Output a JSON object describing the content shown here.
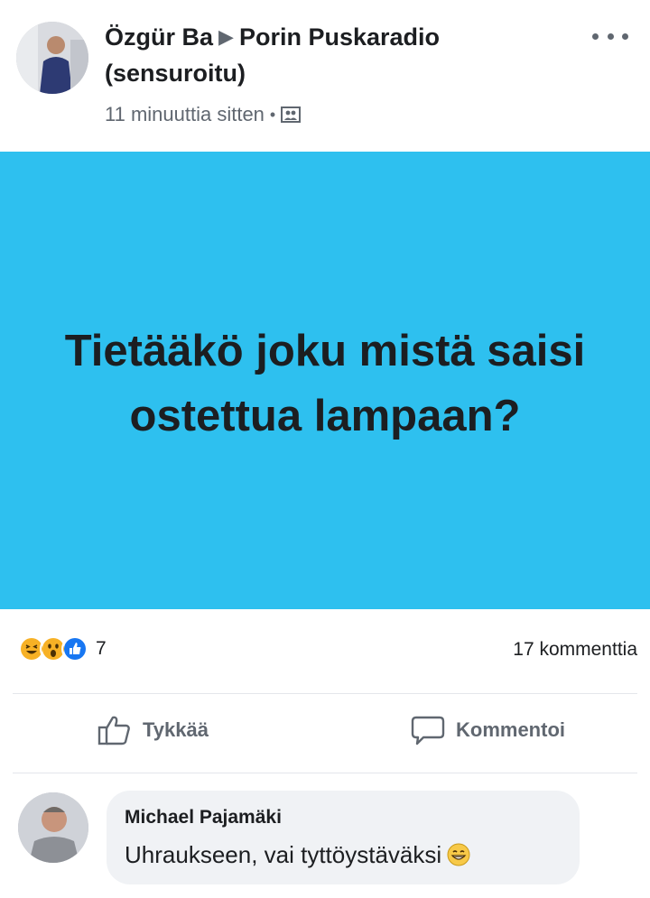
{
  "post": {
    "author": "Özgür Ba",
    "arrow": "▶",
    "group": "Porin Puskaradio",
    "group_note": "(sensuroitu)",
    "timestamp": "11 minuuttia sitten",
    "separator": "•",
    "privacy_icon": "group-icon",
    "more_icon": "more-options-icon"
  },
  "banner": {
    "background": "#2ec0ef",
    "text": "Tietääkö joku mistä saisi ostettua lampaan?"
  },
  "stats": {
    "reactions": [
      "haha",
      "wow",
      "like"
    ],
    "reaction_count": "7",
    "comment_count": "17 kommenttia"
  },
  "actions": {
    "like_label": "Tykkää",
    "comment_label": "Kommentoi"
  },
  "comment": {
    "author": "Michael Pajamäki",
    "text": "Uhraukseen, vai tyttöystäväksi",
    "emoji": "grinning-face-emoji"
  },
  "colors": {
    "text": "#1c1e21",
    "secondary": "#606770",
    "bubble": "#f0f2f5",
    "like_blue": "#1877f2",
    "reaction_yellow": "#f7b125"
  }
}
